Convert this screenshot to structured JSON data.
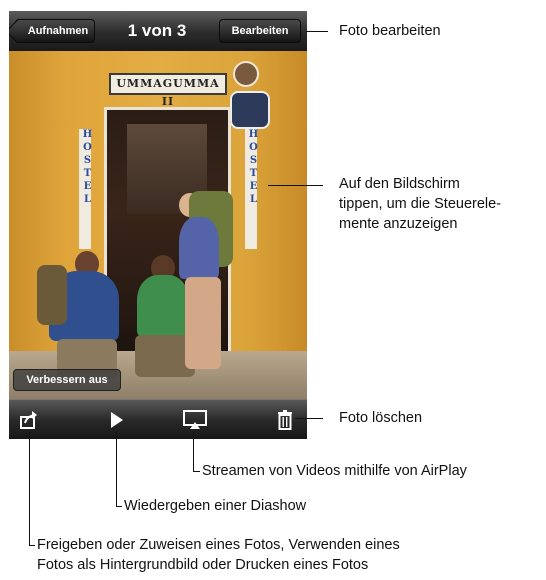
{
  "navbar": {
    "back_label": "Aufnahmen",
    "title": "1 von 3",
    "edit_label": "Bearbeiten"
  },
  "photo": {
    "sign_text": "UMMAGUMMA II",
    "left_vertical_sign": "HOSTEL",
    "right_vertical_sign": "HOSTEL"
  },
  "enhance_button_label": "Verbessern aus",
  "toolbar": {
    "icons": [
      "share-icon",
      "play-icon",
      "airplay-icon",
      "trash-icon"
    ]
  },
  "callouts": {
    "edit": "Foto bearbeiten",
    "tap_line1": "Auf den Bildschirm",
    "tap_line2": "tippen, um die Steuerele-",
    "tap_line3": "mente anzuzeigen",
    "delete": "Foto löschen",
    "airplay": "Streamen von Videos mithilfe von AirPlay",
    "slideshow": "Wiedergeben einer Diashow",
    "share_line1": "Freigeben oder Zuweisen eines Fotos, Verwenden eines",
    "share_line2": "Fotos als Hintergrundbild oder Drucken eines Fotos"
  },
  "colors": {
    "wall": "#e0a53a",
    "bar_dark": "#1a1a1a"
  }
}
